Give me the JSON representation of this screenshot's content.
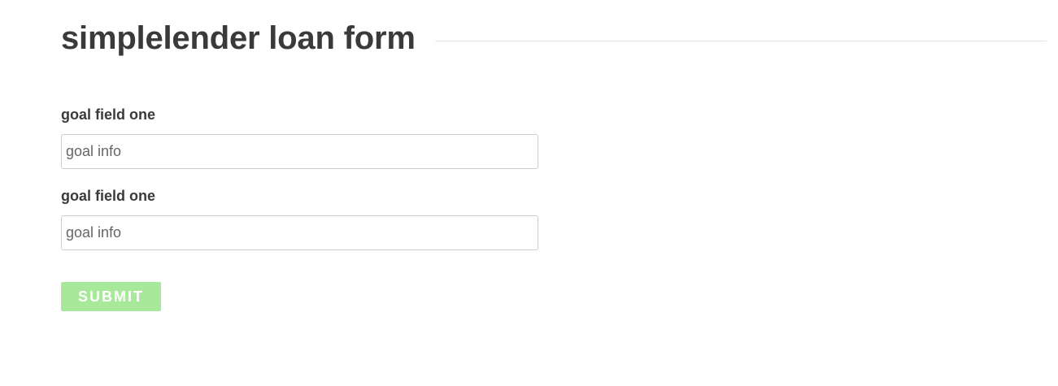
{
  "header": {
    "title": "simplelender loan form"
  },
  "form": {
    "fields": [
      {
        "label": "goal field one",
        "placeholder": "goal info"
      },
      {
        "label": "goal field one",
        "placeholder": "goal info"
      }
    ],
    "submit_label": "SUBMIT"
  },
  "colors": {
    "text": "#3a3a3a",
    "input_border": "#cccccc",
    "submit_background": "#a8e89a",
    "submit_text": "#ffffff",
    "rule": "#e4e4e4"
  }
}
